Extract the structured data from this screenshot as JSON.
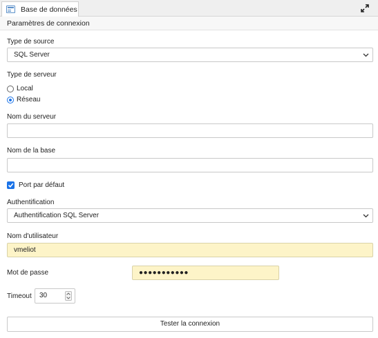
{
  "tab": {
    "title": "Base de données"
  },
  "section": {
    "title": "Paramètres de connexion"
  },
  "source": {
    "label": "Type de source",
    "value": "SQL Server"
  },
  "server_type": {
    "label": "Type de serveur",
    "options": [
      {
        "label": "Local",
        "checked": false
      },
      {
        "label": "Réseau",
        "checked": true
      }
    ]
  },
  "server_name": {
    "label": "Nom du serveur",
    "value": ""
  },
  "db_name": {
    "label": "Nom de la base",
    "value": ""
  },
  "default_port": {
    "label": "Port par défaut",
    "checked": true
  },
  "auth": {
    "label": "Authentification",
    "value": "Authentification SQL Server"
  },
  "username": {
    "label": "Nom d'utilisateur",
    "value": "vmeliot"
  },
  "password": {
    "label": "Mot de passe",
    "value": "●●●●●●●●●●●"
  },
  "timeout": {
    "label": "Timeout",
    "value": "30"
  },
  "test_button": {
    "label": "Tester la connexion"
  },
  "colors": {
    "accent": "#1a73e8",
    "autofill": "#fdf4c8"
  }
}
